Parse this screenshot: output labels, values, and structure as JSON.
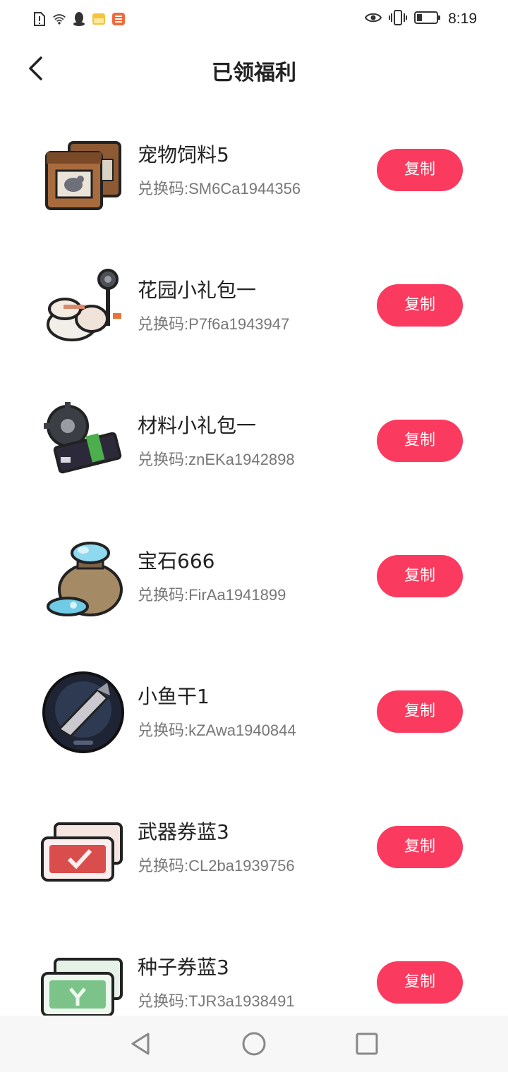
{
  "status_bar": {
    "time": "8:19",
    "left_icons": [
      "sim-alert-icon",
      "wifi-icon",
      "qq-icon",
      "folder-icon",
      "app-icon"
    ],
    "right_icons": [
      "eye-icon",
      "vibrate-icon",
      "battery-icon"
    ]
  },
  "header": {
    "title": "已领福利"
  },
  "items": [
    {
      "name": "宠物饲料5",
      "code": "兑换码:SM6Ca1944356",
      "button": "复制",
      "icon": "pet-food-icon"
    },
    {
      "name": "花园小礼包一",
      "code": "兑换码:P7f6a1943947",
      "button": "复制",
      "icon": "garden-gift-icon"
    },
    {
      "name": "材料小礼包一",
      "code": "兑换码:znEKa1942898",
      "button": "复制",
      "icon": "material-gift-icon"
    },
    {
      "name": "宝石666",
      "code": "兑换码:FirAa1941899",
      "button": "复制",
      "icon": "gem-bag-icon"
    },
    {
      "name": "小鱼干1",
      "code": "兑换码:kZAwa1940844",
      "button": "复制",
      "icon": "dried-fish-icon"
    },
    {
      "name": "武器券蓝3",
      "code": "兑换码:CL2ba1939756",
      "button": "复制",
      "icon": "weapon-ticket-icon"
    },
    {
      "name": "种子券蓝3",
      "code": "兑换码:TJR3a1938491",
      "button": "复制",
      "icon": "seed-ticket-icon"
    }
  ],
  "nav": {
    "icons": [
      "back-triangle-icon",
      "home-circle-icon",
      "recents-square-icon"
    ]
  },
  "colors": {
    "accent": "#fa3a5e"
  }
}
